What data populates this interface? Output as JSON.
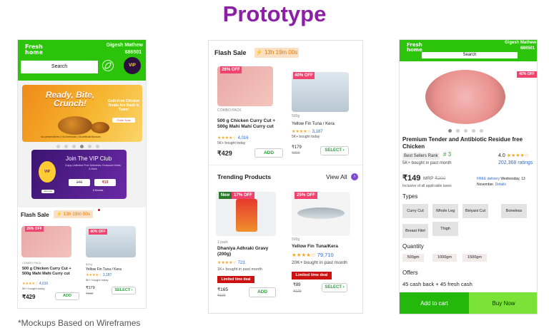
{
  "title": "Prototype",
  "footnote": "*Mockups Based on Wireframes",
  "colors": {
    "brand_green": "#2cc40b",
    "title_purple": "#8b1fa6",
    "sale_pink": "#f0436e",
    "timer_orange": "#e07a00"
  },
  "screen_home": {
    "logo": "Fresh\nhome",
    "user_name": "Gigesh Mathew",
    "pincode": "686501",
    "search_label": "Search",
    "vip_badge": "VIP",
    "banner": {
      "headline": "Ready, Bite, Crunch!",
      "subline": "Guilt-Free Chicken Treats Are Back in Town!",
      "cta": "Order Now",
      "note": "No preservatives | No chemicals | No artificial flavours"
    },
    "vip_banner": {
      "title": "Join The VIP Club",
      "subtitle": "Enjoy Unlimited Free Deliveries, Exclusive Deals & More",
      "badge": "VIP",
      "old_price": "249",
      "new_price": "₹19",
      "join_label": "Join now",
      "duration": "6 Months"
    },
    "flash_label": "Flash Sale",
    "timer": "13h 19m 00s",
    "products": [
      {
        "discount": "26% OFF",
        "pack": "COMBO PACK",
        "name": "500 g Chicken Curry Cut + 500g Mahi Mahi Curry cut",
        "stars": "★★★★☆",
        "count": "4,016",
        "bought": "5K+ bought today",
        "price": "₹429",
        "button": "ADD"
      },
      {
        "discount": "40% OFF",
        "weight": "500g",
        "name": "Yellow Fin Tuna / Kera",
        "stars": "★★★★☆",
        "count": "3,187",
        "bought": "5K+ bought today",
        "price": "₹179",
        "old_price": "₹300",
        "button": "SELECT ›"
      }
    ]
  },
  "screen_listing": {
    "flash_label": "Flash Sale",
    "timer": "13h 19m 00s",
    "flash_products": [
      {
        "discount": "26% OFF",
        "pack": "COMBO PACK",
        "name": "500 g Chicken Curry Cut + 500g Mahi Mahi Curry cut",
        "stars": "★★★★☆",
        "count": "4,016",
        "bought": "5K+ bought today",
        "price": "₹429",
        "button": "ADD"
      },
      {
        "discount": "40% OFF",
        "weight": "500g",
        "name": "Yellow Fin Tuna / Kera",
        "stars": "★★★★☆",
        "count": "3,187",
        "bought": "5K+ bought today",
        "price": "₹179",
        "old_price": "₹300",
        "button": "SELECT ›"
      }
    ],
    "trending_label": "Trending Products",
    "view_all": "View All",
    "trending_products": [
      {
        "new_tag": "New",
        "discount": "17% OFF",
        "weight": "1 pack",
        "name": "Dhaniya Adhrakì Gravy (200g)",
        "stars": "★★★★☆",
        "count": "723",
        "bought": "1K+ bought in past month",
        "deal": "Limited time deal",
        "price": "₹165",
        "old_price": "₹199",
        "button": "ADD"
      },
      {
        "discount": "25% OFF",
        "weight": "500g",
        "name": "Yellow Fin Tuna/Kera",
        "stars": "★★★★☆",
        "count": "79,710",
        "bought": "20K+ bought in past month",
        "deal": "Limited time deal",
        "price": "₹89",
        "old_price": "₹129",
        "button": "SELECT ›"
      }
    ]
  },
  "screen_product": {
    "logo": "Fresh\nhome",
    "user_name": "Gigesh Mathew",
    "pincode": "686501",
    "search_label": "Search",
    "discount": "40% OFF",
    "name": "Premium Tender and Antibiotic Residue free Chicken",
    "rank_label": "Best Sellers Rank",
    "rank": "# 3",
    "rating": "4.0",
    "stars": "★★★★☆",
    "bought": "5K+ bought in past month",
    "ratings_count": "202,368 ratings",
    "price": "₹149",
    "mrp_label": "MRP",
    "mrp": "₹200",
    "tax_note": "Inclusive of all applicable taxes",
    "delivery_free": "FREE delivery",
    "delivery_day": "Wednesday, 13",
    "delivery_month": "November.",
    "details": "Details",
    "types_label": "Types",
    "types": [
      "Curry Cut",
      "Whole Leg",
      "Biriyani Cut",
      "Boneless",
      "Breast Filet",
      "Thigh"
    ],
    "quantity_label": "Quantity",
    "quantities": [
      "500gm",
      "1000gm",
      "1500gm"
    ],
    "offers_label": "Offers",
    "offer_text": "45 cash back + 45 fresh cash",
    "add_to_cart": "Add to cart",
    "buy_now": "Buy Now"
  }
}
